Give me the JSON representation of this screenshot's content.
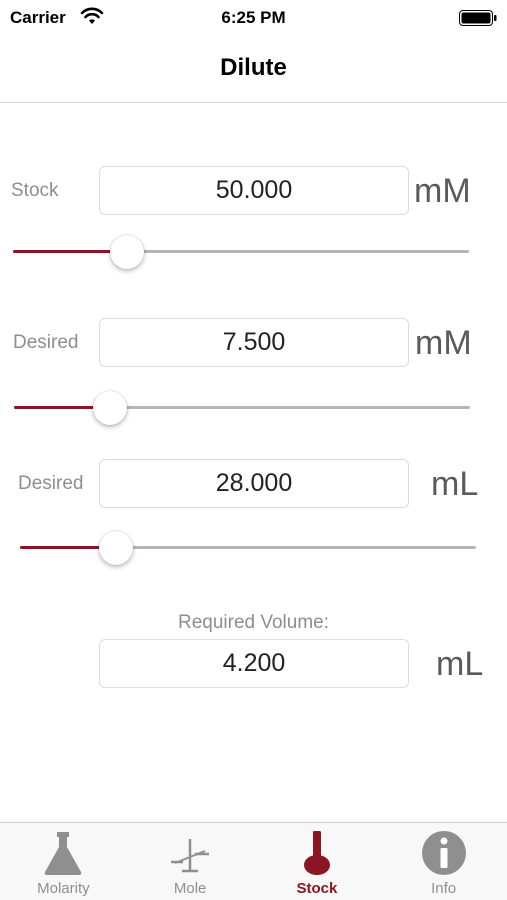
{
  "status_bar": {
    "carrier": "Carrier",
    "time": "6:25 PM"
  },
  "nav": {
    "title": "Dilute"
  },
  "stock": {
    "label": "Stock",
    "value": "50.000",
    "unit": "mM",
    "slider_fraction": 0.25
  },
  "desired_concentration": {
    "label": "Desired",
    "value": "7.500",
    "unit": "mM",
    "slider_fraction": 0.21
  },
  "desired_volume": {
    "label": "Desired",
    "value": "28.000",
    "unit": "mL",
    "slider_fraction": 0.21
  },
  "result": {
    "label": "Required Volume:",
    "value": "4.200",
    "unit": "mL"
  },
  "tabs": [
    {
      "label": "Molarity",
      "icon": "flask-icon",
      "active": false
    },
    {
      "label": "Mole",
      "icon": "scale-icon",
      "active": false
    },
    {
      "label": "Stock",
      "icon": "volumetric-flask-icon",
      "active": true
    },
    {
      "label": "Info",
      "icon": "info-icon",
      "active": false
    }
  ],
  "colors": {
    "accent": "#8a1624",
    "inactive": "#8f8f8f",
    "track": "#b5b5b5"
  }
}
